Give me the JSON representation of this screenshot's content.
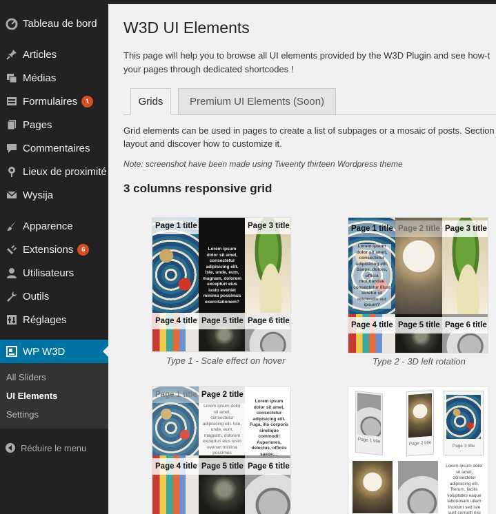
{
  "sidebar": {
    "items": [
      {
        "label": "Tableau de bord",
        "icon": "dashboard-icon"
      },
      {
        "label": "Articles",
        "icon": "pin-icon"
      },
      {
        "label": "Médias",
        "icon": "media-icon"
      },
      {
        "label": "Formulaires",
        "icon": "form-icon",
        "badge": "1"
      },
      {
        "label": "Pages",
        "icon": "pages-icon"
      },
      {
        "label": "Commentaires",
        "icon": "comment-icon"
      },
      {
        "label": "Lieux de proximité",
        "icon": "location-icon"
      },
      {
        "label": "Wysija",
        "icon": "mail-icon"
      },
      {
        "label": "Apparence",
        "icon": "brush-icon"
      },
      {
        "label": "Extensions",
        "icon": "plugin-icon",
        "badge": "6"
      },
      {
        "label": "Utilisateurs",
        "icon": "user-icon"
      },
      {
        "label": "Outils",
        "icon": "wrench-icon"
      },
      {
        "label": "Réglages",
        "icon": "settings-icon"
      },
      {
        "label": "WP W3D",
        "icon": "w3d-icon"
      }
    ],
    "submenu": [
      {
        "label": "All Sliders"
      },
      {
        "label": "UI Elements"
      },
      {
        "label": "Settings"
      }
    ],
    "collapse_label": "Réduire le menu"
  },
  "main": {
    "title": "W3D UI Elements",
    "intro_line1": "This page will help you to browse all UI elements provided by the W3D Plugin and see how-t",
    "intro_line2": "your pages through dedicated shortcodes !",
    "tabs": [
      {
        "label": "Grids"
      },
      {
        "label": "Premium UI Elements (Soon)"
      }
    ],
    "grid_desc_line1": "Grid elements can be used in pages to create a list of subpages or a mosaic of posts. Section",
    "grid_desc_line2": "layout and discover how to customize it.",
    "note": "Note: screenshot have been made using Tweenty thirteen Wordpress theme",
    "section_title": "3 columns responsive grid",
    "thumbs": [
      {
        "caption": "Type 1 - Scale effect on hover",
        "titles": [
          "Page 1 title",
          "Page 3 title",
          "Page 4 title",
          "Page 5 title",
          "Page 6 title"
        ],
        "lorem": "Lorem ipsum dolor sit amet, consectetur adipisicing elit. Iste, unde, eum, magnam, dolorem excepturi eius iusto eveniet minima possimus exercitationem?"
      },
      {
        "caption": "Type 2 - 3D left rotation",
        "titles": [
          "Page 1 title",
          "Page 2 title",
          "Page 3 title",
          "Page 4 title",
          "Page 5 title",
          "Page 6 title"
        ],
        "lorem": "Lorem ipsum dolor sit amet, consectetur adipisicing elit. Saepe, dolore, officia moutlandae consectetur illum tenetur ut reiciendis aut ipsum?"
      },
      {
        "titles": [
          "Page 1 title",
          "Page 2 title",
          "Page 4 title",
          "Page 5 title",
          "Page 6 title"
        ],
        "lorem_a": "Lorem ipsum dolor sit amet, consectetur adipisicing elit. Iste, unde, eum, magnam, dolorem excepturi eius iusto eveniet minima possimus exercitationem?",
        "lorem_b": "Lorem ipsum dolor sit amet, consectetur adipisicing elit. Fuga, illo corporis similique commodi! Asperiores, delectus, officiis saepe...."
      },
      {
        "labels": [
          "Page 1 title",
          "Page 2 title",
          "Page 3 title"
        ],
        "lorem": "Lorem ipsum dolor sit amet, consectetur adipisicing elit. Rerum, facilis voluptates eaque laboriosam ullam Incidunt sed iste sunt corrupti nisi quas praesentium tenetur dolore est!"
      }
    ]
  }
}
